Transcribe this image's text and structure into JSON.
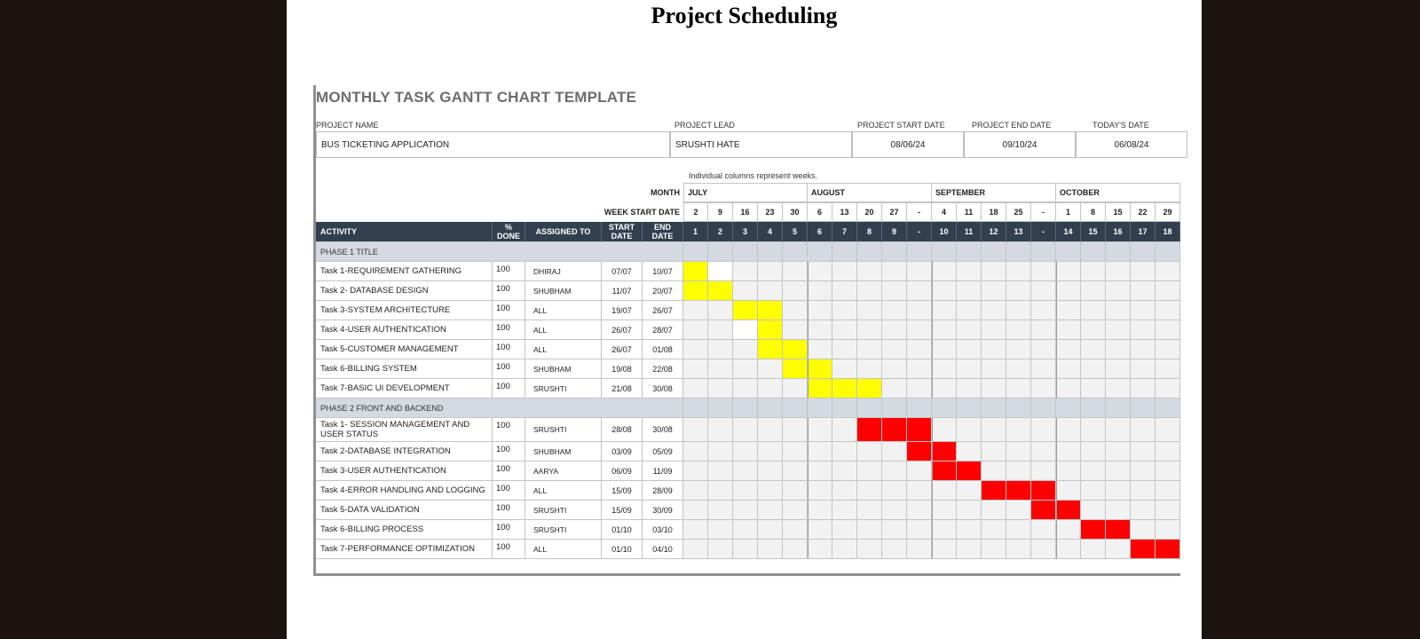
{
  "doc_title": "Project Scheduling",
  "sheet_title": "MONTHLY TASK GANTT CHART TEMPLATE",
  "info": {
    "project_name_label": "PROJECT NAME",
    "project_name": "BUS TICKETING APPLICATION",
    "project_lead_label": "PROJECT LEAD",
    "project_lead": "SRUSHTI HATE",
    "start_label": "PROJECT START DATE",
    "start": "08/06/24",
    "end_label": "PROJECT END DATE",
    "end": "09/10/24",
    "today_label": "TODAY'S DATE",
    "today": "06/08/24"
  },
  "note": "Individual columns represent weeks.",
  "month_label": "MONTH",
  "week_label": "WEEK START DATE",
  "months": [
    "JULY",
    "AUGUST",
    "SEPTEMBER",
    "OCTOBER"
  ],
  "week_starts": [
    "2",
    "9",
    "16",
    "23",
    "30",
    "6",
    "13",
    "20",
    "27",
    "-",
    "4",
    "11",
    "18",
    "25",
    "-",
    "1",
    "8",
    "15",
    "22",
    "29"
  ],
  "week_numbers": [
    "1",
    "2",
    "3",
    "4",
    "5",
    "6",
    "7",
    "8",
    "9",
    "-",
    "10",
    "11",
    "12",
    "13",
    "-",
    "14",
    "15",
    "16",
    "17",
    "18"
  ],
  "headers": {
    "activity": "ACTIVITY",
    "done": "% DONE",
    "assigned": "ASSIGNED TO",
    "start": "START DATE",
    "end": "END DATE"
  },
  "phases": [
    {
      "title": "PHASE 1 TITLE",
      "color": "#ffff00",
      "tasks": [
        {
          "name": "Task 1-REQUIREMENT GATHERING",
          "done": "100",
          "assigned": "DHIRAJ",
          "start": "07/07",
          "end": "10/07",
          "weeks": [
            0
          ],
          "white": [
            1
          ]
        },
        {
          "name": "Task 2- DATABASE DESIGN",
          "done": "100",
          "assigned": "SHUBHAM",
          "start": "11/07",
          "end": "20/07",
          "weeks": [
            0,
            1
          ],
          "white": []
        },
        {
          "name": "Task 3-SYSTEM ARCHITECTURE",
          "done": "100",
          "assigned": "ALL",
          "start": "19/07",
          "end": "26/07",
          "weeks": [
            2,
            3
          ],
          "white": []
        },
        {
          "name": "Task 4-USER AUTHENTICATION",
          "done": "100",
          "assigned": "ALL",
          "start": "26/07",
          "end": "28/07",
          "weeks": [
            3
          ],
          "white": [
            2
          ]
        },
        {
          "name": "Task 5-CUSTOMER MANAGEMENT",
          "done": "100",
          "assigned": "ALL",
          "start": "26/07",
          "end": "01/08",
          "weeks": [
            3,
            4
          ],
          "white": []
        },
        {
          "name": "Task 6-BILLING SYSTEM",
          "done": "100",
          "assigned": "SHUBHAM",
          "start": "19/08",
          "end": "22/08",
          "weeks": [
            4,
            5
          ],
          "white": []
        },
        {
          "name": "Task 7-BASIC UI DEVELOPMENT",
          "done": "100",
          "assigned": "SRUSHTI",
          "start": "21/08",
          "end": "30/08",
          "weeks": [
            5,
            6,
            7
          ],
          "white": []
        }
      ]
    },
    {
      "title": "PHASE 2 FRONT AND BACKEND",
      "color": "#ff0000",
      "tasks": [
        {
          "name": "Task 1- SESSION MANAGEMENT AND USER STATUS",
          "done": "100",
          "assigned": "SRUSHTI",
          "start": "28/08",
          "end": "30/08",
          "weeks": [
            7,
            8,
            9
          ],
          "white": []
        },
        {
          "name": "Task 2-DATABASE INTEGRATION",
          "done": "100",
          "assigned": "SHUBHAM",
          "start": "03/09",
          "end": "05/09",
          "weeks": [
            9,
            10
          ],
          "white": []
        },
        {
          "name": "Task 3-USER AUTHENTICATION",
          "done": "100",
          "assigned": "AARYA",
          "start": "06/09",
          "end": "11/09",
          "weeks": [
            10,
            11
          ],
          "white": []
        },
        {
          "name": "Task 4-ERROR HANDLING AND LOGGING",
          "done": "100",
          "assigned": "ALL",
          "start": "15/09",
          "end": "28/09",
          "weeks": [
            12,
            13,
            14
          ],
          "white": []
        },
        {
          "name": "Task 5-DATA VALIDATION",
          "done": "100",
          "assigned": "SRUSHTI",
          "start": "15/09",
          "end": "30/09",
          "weeks": [
            14,
            15
          ],
          "white": []
        },
        {
          "name": "Task 6-BILLING PROCESS",
          "done": "100",
          "assigned": "SRUSHTI",
          "start": "01/10",
          "end": "03/10",
          "weeks": [
            16,
            17
          ],
          "white": []
        },
        {
          "name": "Task 7-PERFORMANCE OPTIMIZATION",
          "done": "100",
          "assigned": "ALL",
          "start": "01/10",
          "end": "04/10",
          "weeks": [
            18,
            19
          ],
          "white": []
        }
      ]
    }
  ]
}
